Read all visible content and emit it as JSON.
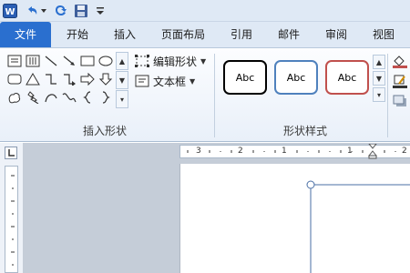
{
  "quick_access": {
    "app_icon": "wps-writer-icon",
    "undo_icon": "undo-icon",
    "redo_icon": "redo-icon",
    "save_icon": "save-icon",
    "customize_icon": "customize-toolbar-icon"
  },
  "tabs": [
    {
      "label": "文件",
      "active": true
    },
    {
      "label": "开始",
      "active": false
    },
    {
      "label": "插入",
      "active": false
    },
    {
      "label": "页面布局",
      "active": false
    },
    {
      "label": "引用",
      "active": false
    },
    {
      "label": "邮件",
      "active": false
    },
    {
      "label": "审阅",
      "active": false
    },
    {
      "label": "视图",
      "active": false
    }
  ],
  "ribbon": {
    "insert_shapes": {
      "edit_shape_label": "编辑形状",
      "text_box_label": "文本框",
      "group_label": "插入形状"
    },
    "shape_styles": {
      "samples": [
        {
          "text": "Abc",
          "border": "#000000"
        },
        {
          "text": "Abc",
          "border": "#4f81bd"
        },
        {
          "text": "Abc",
          "border": "#c0504d"
        }
      ],
      "group_label": "形状样式"
    }
  },
  "ruler": {
    "h_labels": [
      "3",
      "2",
      "1",
      "1",
      "2"
    ],
    "tab_selector_icon": "tab-stop-selector-icon"
  },
  "colors": {
    "tab_active": "#2a6fcf",
    "ribbon_bg": "#e9f0f9",
    "doc_bg": "#c5cdd8"
  }
}
